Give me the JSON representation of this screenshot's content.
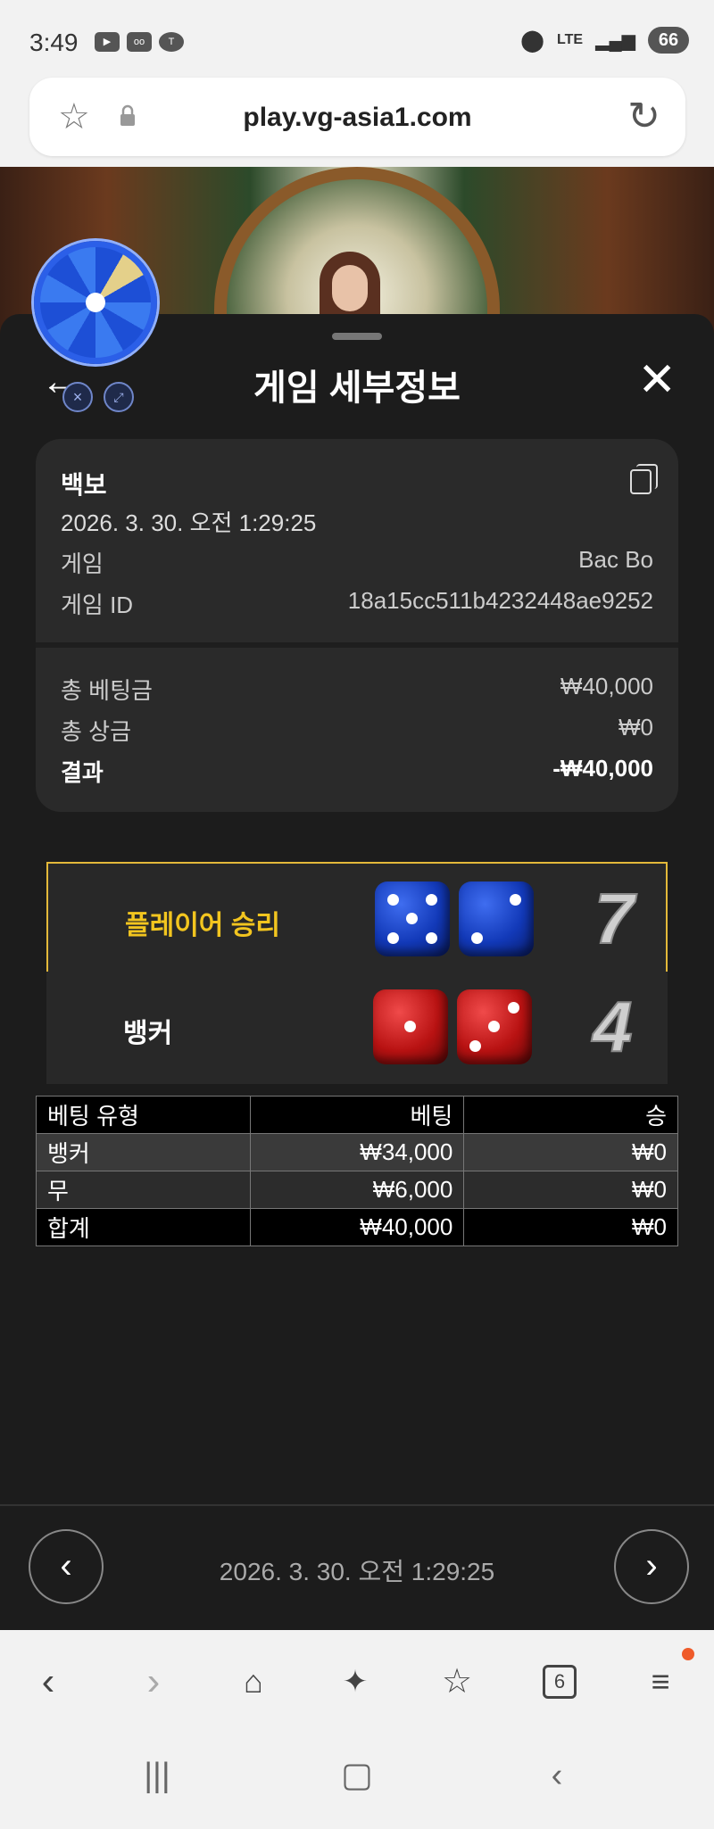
{
  "status_bar": {
    "time": "3:49",
    "icons": [
      "youtube-icon",
      "voicemail-icon",
      "kakaotalk-icon"
    ],
    "network": "LTE",
    "battery": "66"
  },
  "browser": {
    "url": "play.vg-asia1.com",
    "tabs_count": "6"
  },
  "sheet": {
    "title": "게임 세부정보"
  },
  "details": {
    "game_name": "백보",
    "timestamp": "2026. 3. 30. 오전 1:29:25",
    "game_label": "게임",
    "game_value": "Bac Bo",
    "id_label": "게임 ID",
    "id_value": "18a15cc511b4232448ae9252",
    "total_bet_label": "총 베팅금",
    "total_bet_value": "₩40,000",
    "total_win_label": "총 상금",
    "total_win_value": "₩0",
    "result_label": "결과",
    "result_value": "-₩40,000"
  },
  "results": {
    "player": {
      "label": "플레이어 승리",
      "dice": [
        5,
        2
      ],
      "sum": "7"
    },
    "banker": {
      "label": "뱅커",
      "dice": [
        1,
        3
      ],
      "sum": "4"
    }
  },
  "bet_table": {
    "headers": [
      "베팅 유형",
      "베팅",
      "승"
    ],
    "rows": [
      [
        "뱅커",
        "₩34,000",
        "₩0"
      ],
      [
        "무",
        "₩6,000",
        "₩0"
      ],
      [
        "합계",
        "₩40,000",
        "₩0"
      ]
    ]
  },
  "footer": {
    "timestamp": "2026. 3. 30. 오전 1:29:25"
  },
  "colors": {
    "winner_border": "#e3b93a",
    "winner_text": "#f2c51f",
    "player_die": "#1239b8",
    "banker_die": "#b81212",
    "menu_notification": "#ef5b2a"
  }
}
